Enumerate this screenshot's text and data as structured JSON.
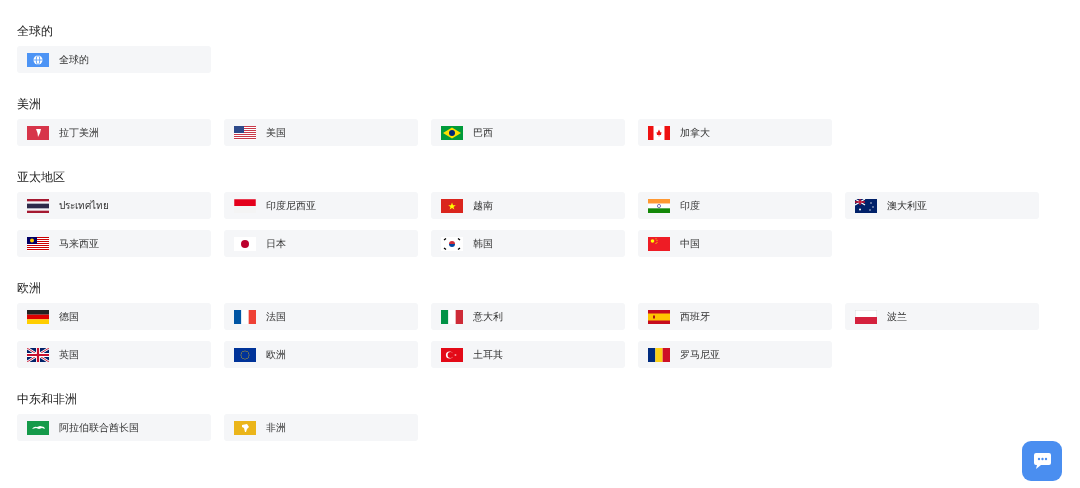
{
  "sections": [
    {
      "title": "全球的",
      "items": [
        {
          "label": "全球的",
          "kind": "globe"
        }
      ]
    },
    {
      "title": "美洲",
      "items": [
        {
          "label": "拉丁美洲",
          "kind": "latam"
        },
        {
          "label": "美国",
          "kind": "us"
        },
        {
          "label": "巴西",
          "kind": "br"
        },
        {
          "label": "加拿大",
          "kind": "ca"
        }
      ]
    },
    {
      "title": "亚太地区",
      "items": [
        {
          "label": "ประเทศไทย",
          "kind": "th"
        },
        {
          "label": "印度尼西亚",
          "kind": "id"
        },
        {
          "label": "越南",
          "kind": "vn"
        },
        {
          "label": "印度",
          "kind": "in"
        },
        {
          "label": "澳大利亚",
          "kind": "au"
        },
        {
          "label": "马来西亚",
          "kind": "my"
        },
        {
          "label": "日本",
          "kind": "jp"
        },
        {
          "label": "韩国",
          "kind": "kr"
        },
        {
          "label": "中国",
          "kind": "cn"
        }
      ]
    },
    {
      "title": "欧洲",
      "items": [
        {
          "label": "德国",
          "kind": "de"
        },
        {
          "label": "法国",
          "kind": "fr"
        },
        {
          "label": "意大利",
          "kind": "it"
        },
        {
          "label": "西班牙",
          "kind": "es"
        },
        {
          "label": "波兰",
          "kind": "pl"
        },
        {
          "label": "英国",
          "kind": "gb"
        },
        {
          "label": "欧洲",
          "kind": "eu"
        },
        {
          "label": "土耳其",
          "kind": "tr"
        },
        {
          "label": "罗马尼亚",
          "kind": "ro"
        }
      ]
    },
    {
      "title": "中东和非洲",
      "items": [
        {
          "label": "阿拉伯联合酋长国",
          "kind": "arab"
        },
        {
          "label": "非洲",
          "kind": "africa"
        }
      ]
    }
  ]
}
